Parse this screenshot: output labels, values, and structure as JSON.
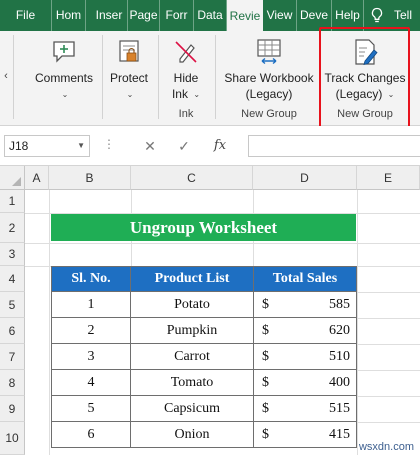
{
  "tabs": [
    {
      "label": "File",
      "active": false
    },
    {
      "label": "Hom",
      "active": false
    },
    {
      "label": "Inser",
      "active": false
    },
    {
      "label": "Page",
      "active": false
    },
    {
      "label": "Forr",
      "active": false
    },
    {
      "label": "Data",
      "active": false
    },
    {
      "label": "Revie",
      "active": true
    },
    {
      "label": "View",
      "active": false
    },
    {
      "label": "Deve",
      "active": false
    },
    {
      "label": "Help",
      "active": false
    },
    {
      "label": "Tell",
      "active": false
    }
  ],
  "ribbon": {
    "comments": {
      "label": "Comments"
    },
    "protect": {
      "label": "Protect"
    },
    "hide_ink": {
      "line1": "Hide",
      "line2": "Ink",
      "group_label": "Ink"
    },
    "share_workbook": {
      "line1": "Share Workbook",
      "line2": "(Legacy)",
      "group_label": "New Group"
    },
    "track_changes": {
      "line1": "Track Changes",
      "line2": "(Legacy)",
      "group_label": "New Group"
    }
  },
  "formula_bar": {
    "name_box": "J18",
    "fx_label": "fx",
    "formula": ""
  },
  "columns": [
    "A",
    "B",
    "C",
    "D",
    "E"
  ],
  "rows": [
    "1",
    "2",
    "3",
    "4",
    "5",
    "6",
    "7",
    "8",
    "9",
    "10"
  ],
  "sheet": {
    "title": "Ungroup Worksheet",
    "headers": [
      "Sl. No.",
      "Product List",
      "Total Sales"
    ],
    "records": [
      {
        "sl": "1",
        "product": "Potato",
        "currency": "$",
        "sales": "585"
      },
      {
        "sl": "2",
        "product": "Pumpkin",
        "currency": "$",
        "sales": "620"
      },
      {
        "sl": "3",
        "product": "Carrot",
        "currency": "$",
        "sales": "510"
      },
      {
        "sl": "4",
        "product": "Tomato",
        "currency": "$",
        "sales": "400"
      },
      {
        "sl": "5",
        "product": "Capsicum",
        "currency": "$",
        "sales": "515"
      },
      {
        "sl": "6",
        "product": "Onion",
        "currency": "$",
        "sales": "415"
      }
    ]
  },
  "watermark": "wsxdn.com",
  "colors": {
    "ribbon_tab_bg": "#217346",
    "title_banner": "#1fae55",
    "table_header": "#1e6fc2",
    "highlight_box": "#e8121c"
  }
}
